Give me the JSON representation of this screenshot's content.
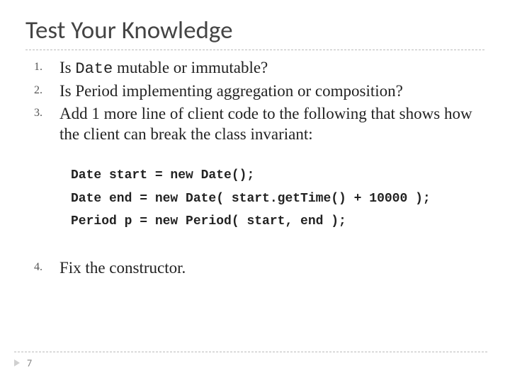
{
  "title": "Test Your Knowledge",
  "items": {
    "q1_a": "Is ",
    "q1_code": "Date",
    "q1_b": " mutable or immutable?",
    "q2": "Is Period implementing aggregation or composition?",
    "q3": "Add 1 more line of client code to the following that shows how the client can break the class invariant:",
    "q4": "Fix the constructor."
  },
  "code": {
    "l1": "Date start = new Date();",
    "l2": "Date end = new Date( start.getTime() + 10000 );",
    "l3": "Period p = new Period( start, end );"
  },
  "page": "7"
}
